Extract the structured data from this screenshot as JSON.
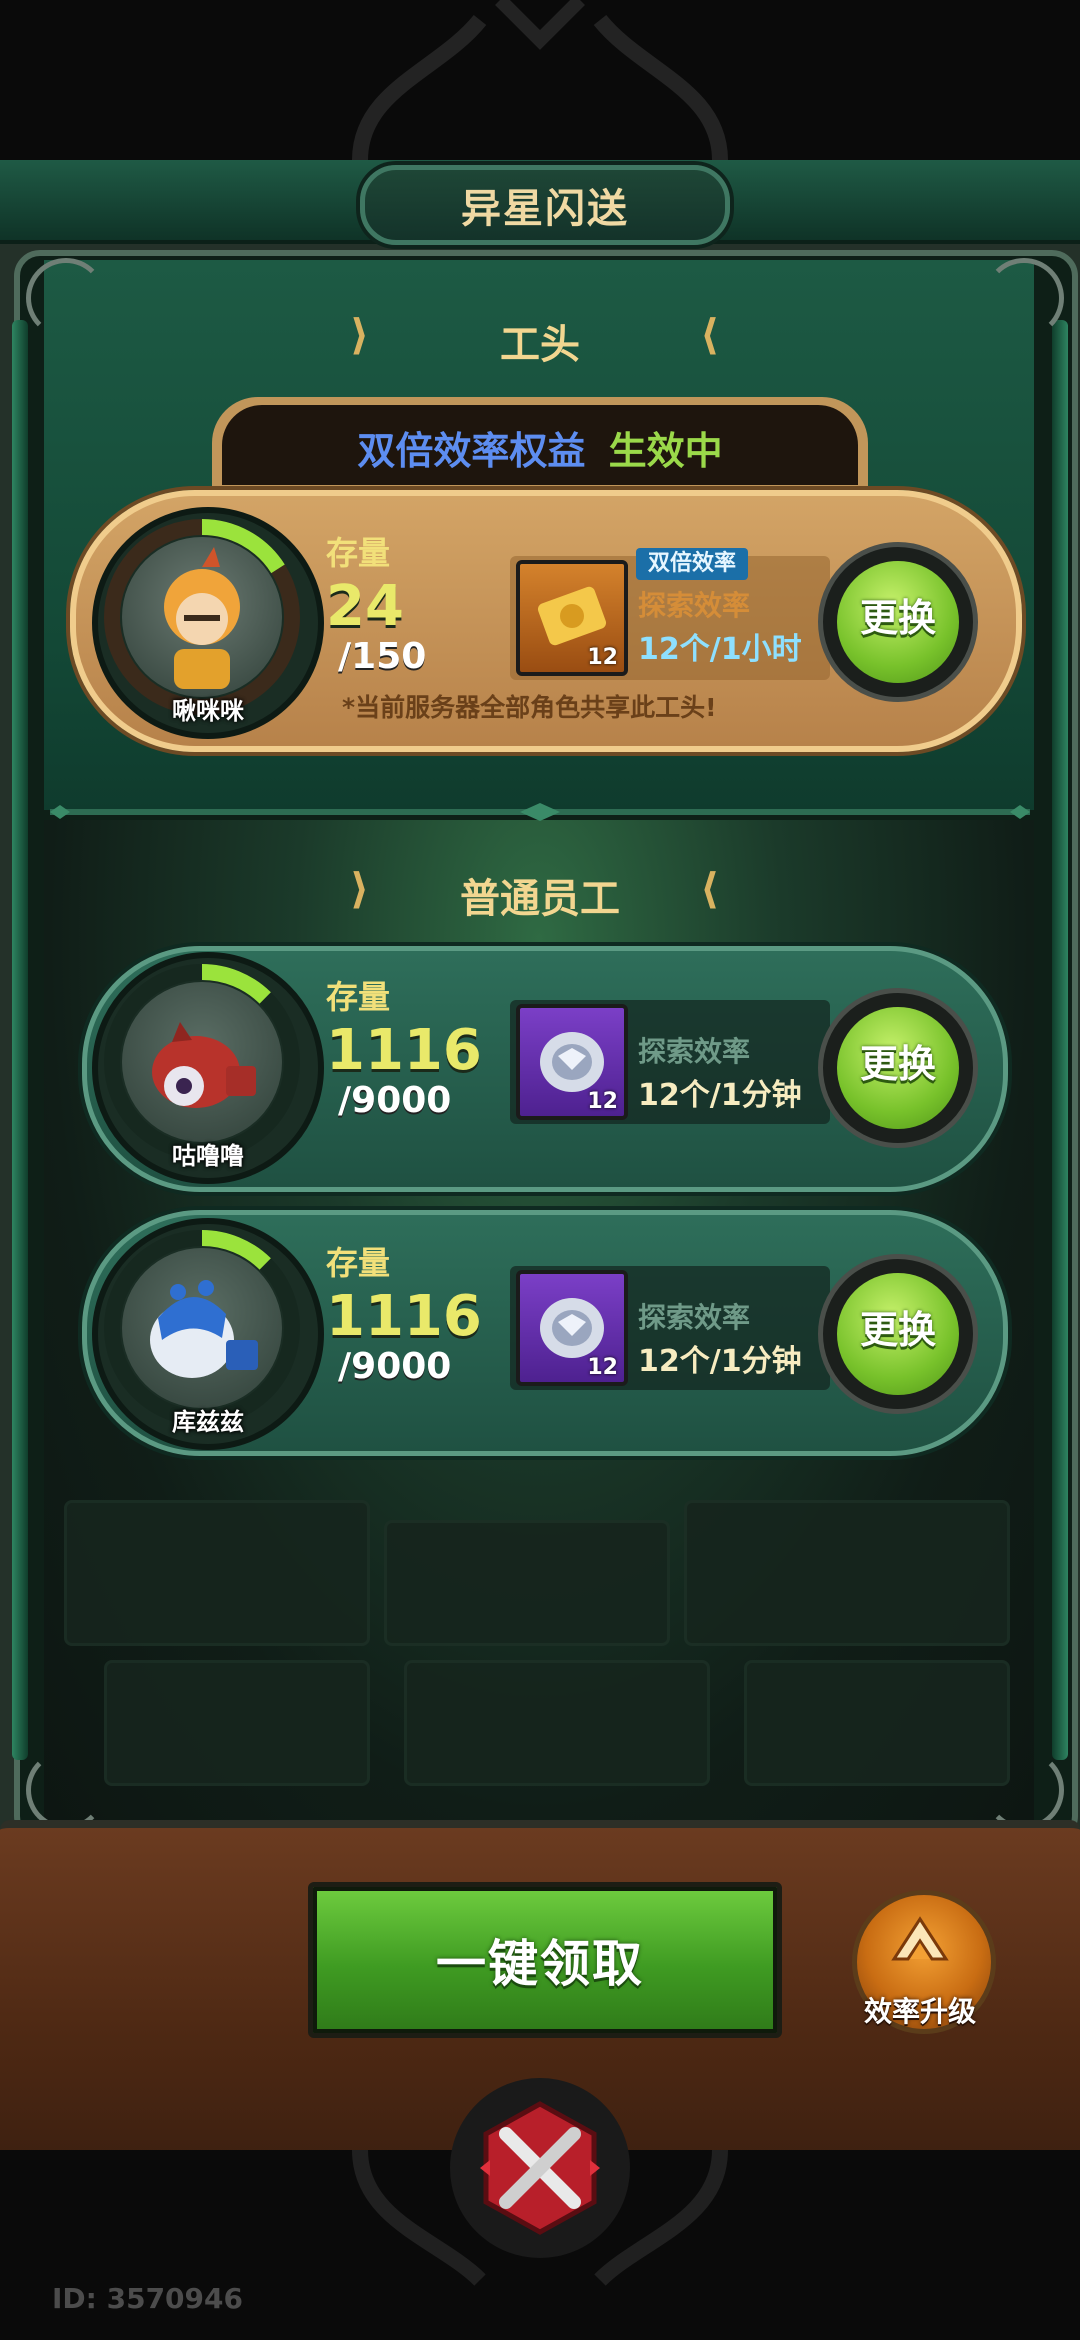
{
  "title": "异星闪送",
  "boss_section": {
    "title": "工头",
    "status_benefit": "双倍效率权益",
    "status_active": "生效中",
    "worker": {
      "name": "啾咪咪",
      "stock_label": "存量",
      "count": "24",
      "capacity": "/150",
      "progress": 0.16,
      "item_count": "12",
      "double_tag": "双倍效率",
      "efficiency_label": "探索效率",
      "rate": "12个/1小时",
      "swap_label": "更换"
    },
    "note": "*当前服务器全部角色共享此工头!"
  },
  "staff_section": {
    "title": "普通员工",
    "workers": [
      {
        "name": "咕噜噜",
        "stock_label": "存量",
        "count": "1116",
        "capacity": "/9000",
        "progress": 0.124,
        "item_count": "12",
        "efficiency_label": "探索效率",
        "rate": "12个/1分钟",
        "swap_label": "更换"
      },
      {
        "name": "库兹兹",
        "stock_label": "存量",
        "count": "1116",
        "capacity": "/9000",
        "progress": 0.124,
        "item_count": "12",
        "efficiency_label": "探索效率",
        "rate": "12个/1分钟",
        "swap_label": "更换"
      }
    ]
  },
  "claim_button": "一键领取",
  "upgrade_button": "效率升级",
  "user_id": "ID: 3570946",
  "colors": {
    "benefit_blue": "#5d8df0",
    "active_green": "#9bd94a",
    "progress_green": "#9be33c",
    "accent_gold": "#f2d690"
  },
  "icons": [
    "chevron-right-icon",
    "chevron-left-icon",
    "gold-ticket-icon",
    "silver-coin-icon",
    "upgrade-arrow-icon",
    "close-x-icon"
  ]
}
